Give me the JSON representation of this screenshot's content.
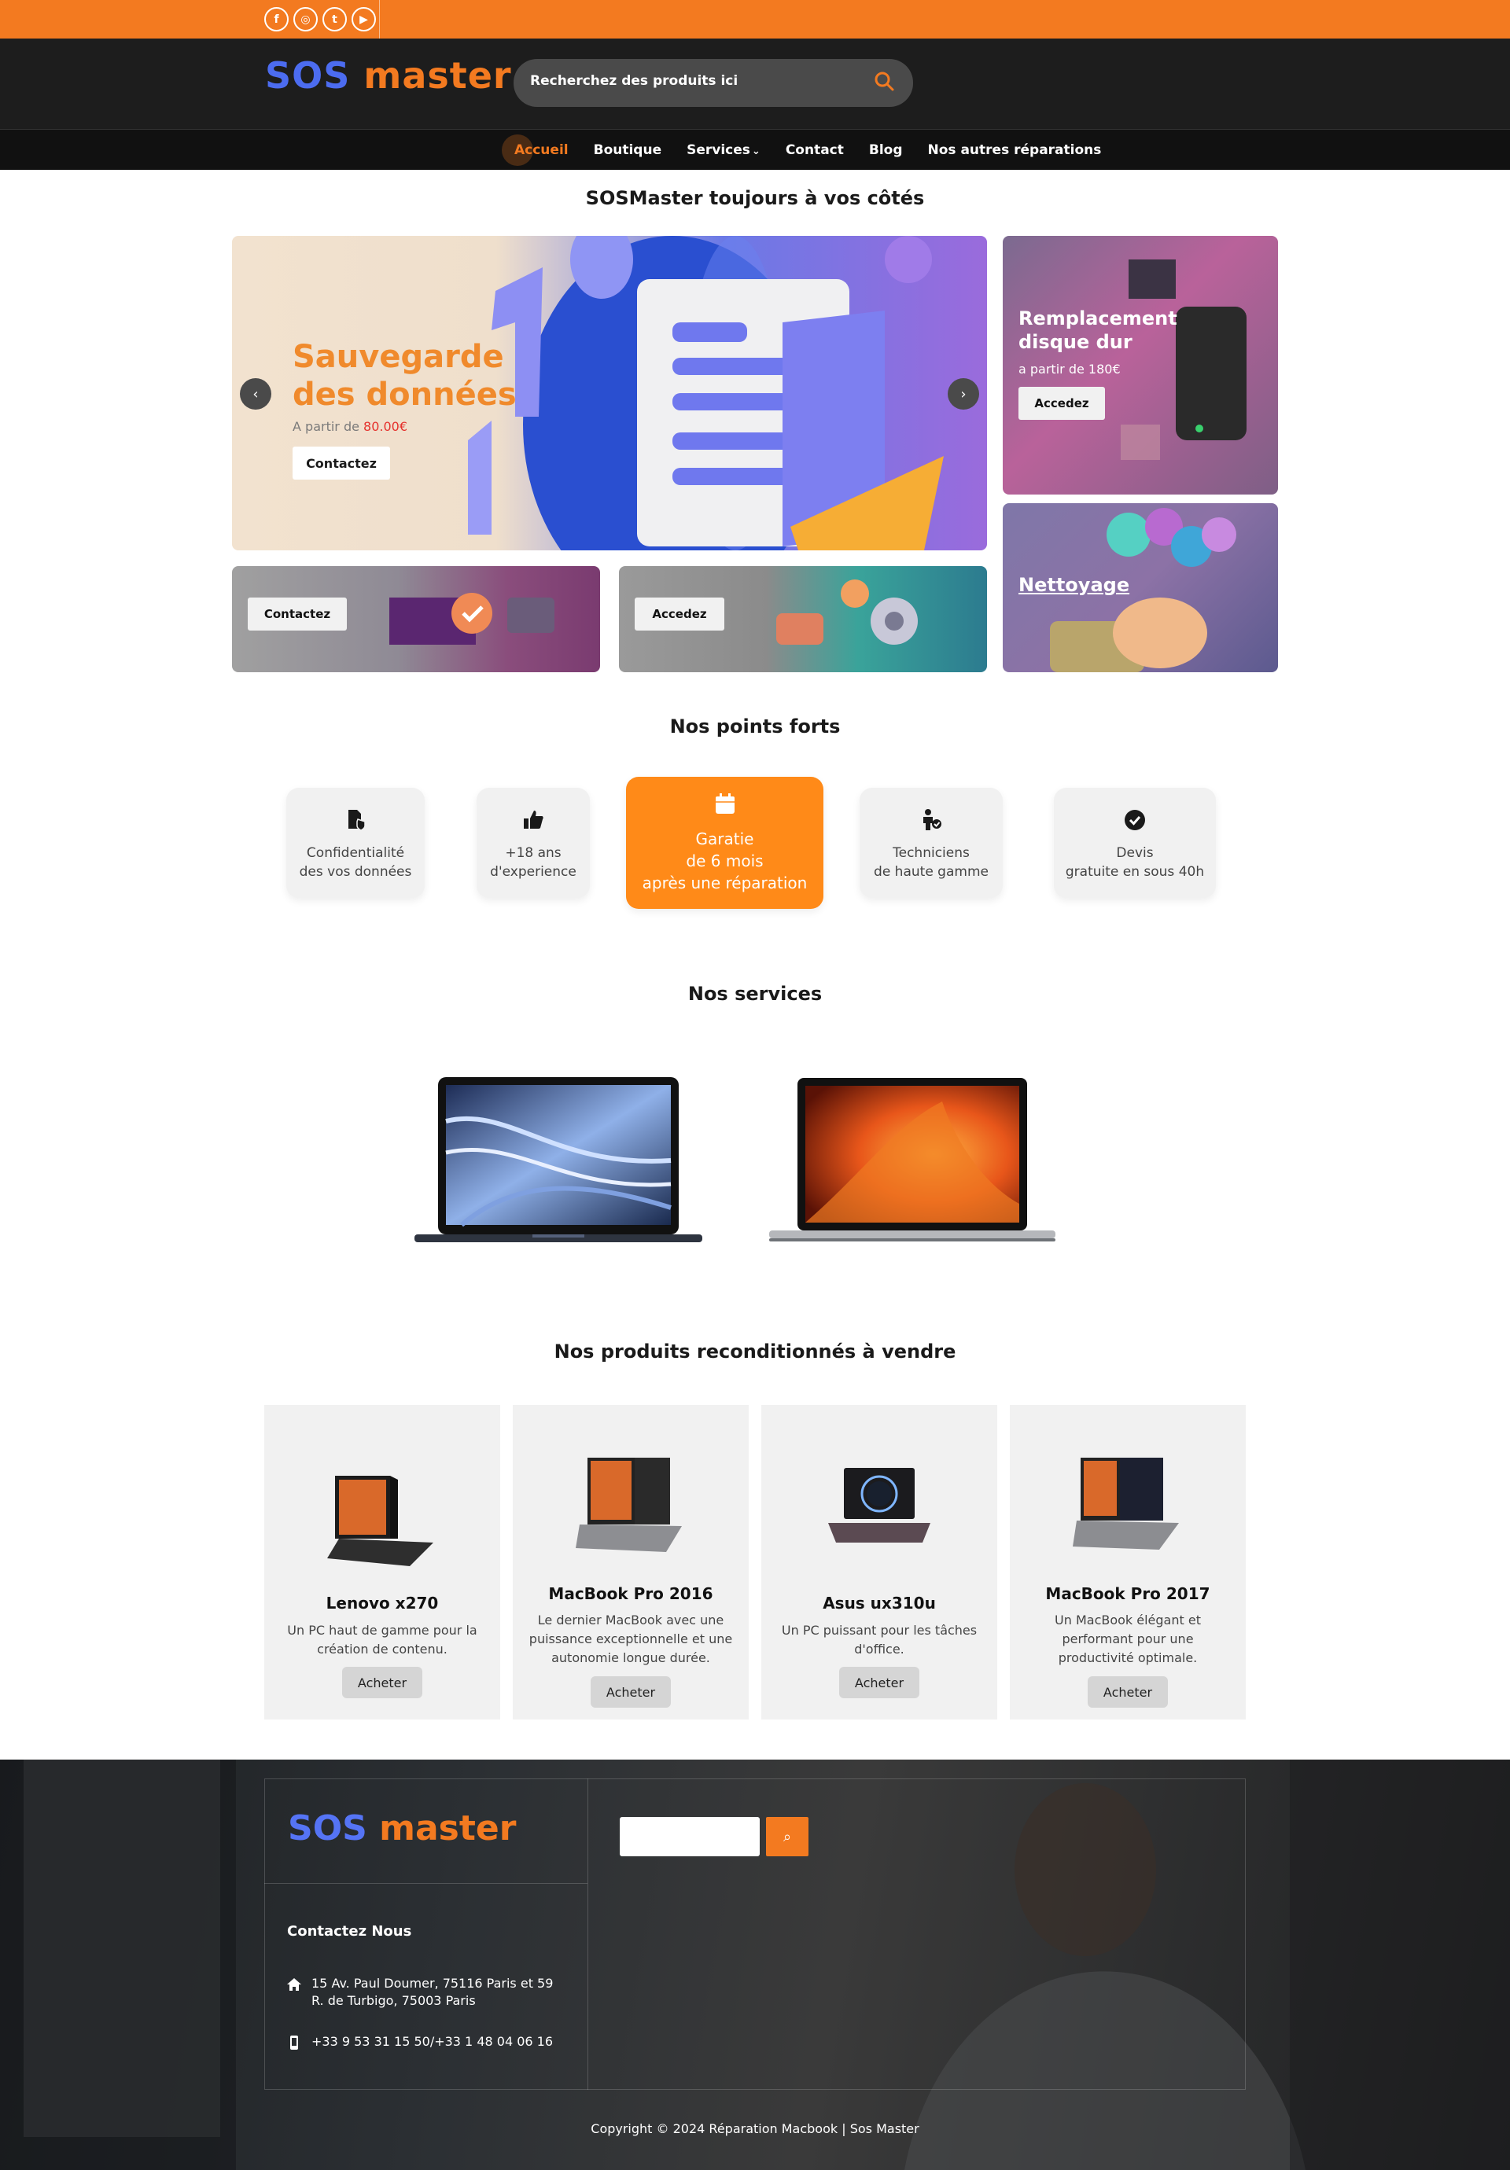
{
  "brand": {
    "sos": "SOS",
    "master": "master"
  },
  "colors": {
    "accent": "#f37a20",
    "brand_blue": "#4c6cf0",
    "dark": "#1d1d1d"
  },
  "social": [
    {
      "icon": "facebook-icon",
      "glyph": "f"
    },
    {
      "icon": "instagram-icon",
      "glyph": "◎"
    },
    {
      "icon": "twitter-icon",
      "glyph": "t"
    },
    {
      "icon": "youtube-icon",
      "glyph": "▶"
    }
  ],
  "search": {
    "placeholder": "Recherchez des produits ici"
  },
  "nav": {
    "items": [
      {
        "label": "Accueil",
        "active": true
      },
      {
        "label": "Boutique"
      },
      {
        "label": "Services",
        "has_dropdown": true
      },
      {
        "label": "Contact"
      },
      {
        "label": "Blog"
      },
      {
        "label": "Nos autres réparations"
      }
    ]
  },
  "headline": "SOSMaster toujours à vos côtés",
  "hero": {
    "title": "Sauvegarde des données",
    "price_prefix": "A partir de",
    "price_value": "80.00€",
    "button": "Contactez"
  },
  "side_cards": {
    "disk": {
      "title": "Remplacement disque dur",
      "subtitle": "a partir de 180€",
      "button": "Accedez"
    },
    "cleaning": {
      "title": "Nettoyage"
    }
  },
  "bottom_cards": [
    {
      "button": "Contactez"
    },
    {
      "button": "Accedez"
    }
  ],
  "strengths": {
    "title": "Nos points forts",
    "items": [
      {
        "icon": "shield-file-icon",
        "line1": "Confidentialité",
        "line2": "des vos données"
      },
      {
        "icon": "thumbs-up-icon",
        "line1": "+18 ans",
        "line2": "d'experience"
      },
      {
        "icon": "calendar-icon",
        "line1": "Garatie",
        "line2": "de 6 mois",
        "line3": "après une réparation",
        "highlight": true
      },
      {
        "icon": "technician-icon",
        "line1": "Techniciens",
        "line2": "de haute gamme"
      },
      {
        "icon": "check-circle-icon",
        "line1": "Devis",
        "line2": "gratuite en sous 40h"
      }
    ]
  },
  "services": {
    "title": "Nos services"
  },
  "products": {
    "title": "Nos produits reconditionnés à vendre",
    "items": [
      {
        "name": "Lenovo x270",
        "desc": "Un PC haut de gamme pour la création de contenu.",
        "button": "Acheter"
      },
      {
        "name": "MacBook Pro 2016",
        "desc": "Le dernier MacBook avec une puissance exceptionnelle et une autonomie longue durée.",
        "button": "Acheter"
      },
      {
        "name": "Asus ux310u",
        "desc": "Un PC puissant pour les tâches d'office.",
        "button": "Acheter"
      },
      {
        "name": "MacBook Pro 2017",
        "desc": "Un MacBook élégant et performant pour une productivité optimale.",
        "button": "Acheter"
      }
    ]
  },
  "footer": {
    "contact_title": "Contactez Nous",
    "address": "15 Av. Paul Doumer, 75116 Paris et 59 R. de Turbigo, 75003 Paris",
    "phone": "+33 9 53 31 15 50/+33 1 48 04 06 16",
    "copyright": "Copyright © 2024 Réparation Macbook | Sos Master"
  }
}
